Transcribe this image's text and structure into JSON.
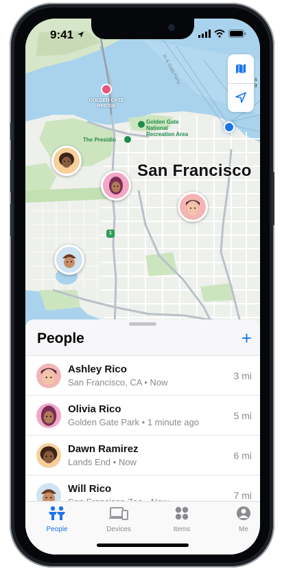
{
  "status_bar": {
    "time": "9:41"
  },
  "map": {
    "city_label": "San Francisco",
    "labels": {
      "golden_gate_bridge": "GOLDEN GATE\nBRIDGE",
      "presidio": "The Presidio",
      "ggnra": "Golden Gate\nNational\nRecreation Area",
      "highway_shield": "1",
      "street": "Jo & Gold Ferry",
      "edge": "s\nir"
    },
    "controls": {
      "map_icon": "map-icon",
      "location_icon": "location-arrow-icon"
    }
  },
  "people_sheet": {
    "title": "People",
    "add_icon": "+",
    "people": [
      {
        "name": "Ashley Rico",
        "location": "San Francisco, CA • Now",
        "distance": "3 mi",
        "color": "#f4b4b4"
      },
      {
        "name": "Olivia Rico",
        "location": "Golden Gate Park • 1 minute ago",
        "distance": "5 mi",
        "color": "#f2a7c6"
      },
      {
        "name": "Dawn Ramirez",
        "location": "Lands End • Now",
        "distance": "6 mi",
        "color": "#f6cf9a"
      },
      {
        "name": "Will Rico",
        "location": "San Francisco Zoo • Now",
        "distance": "7 mi",
        "color": "#cfe3f1"
      }
    ]
  },
  "tab_bar": {
    "tabs": [
      {
        "label": "People",
        "icon": "people-icon",
        "active": true
      },
      {
        "label": "Devices",
        "icon": "devices-icon",
        "active": false
      },
      {
        "label": "Items",
        "icon": "items-icon",
        "active": false
      },
      {
        "label": "Me",
        "icon": "me-icon",
        "active": false
      }
    ],
    "accent_color": "#1a73e8"
  }
}
